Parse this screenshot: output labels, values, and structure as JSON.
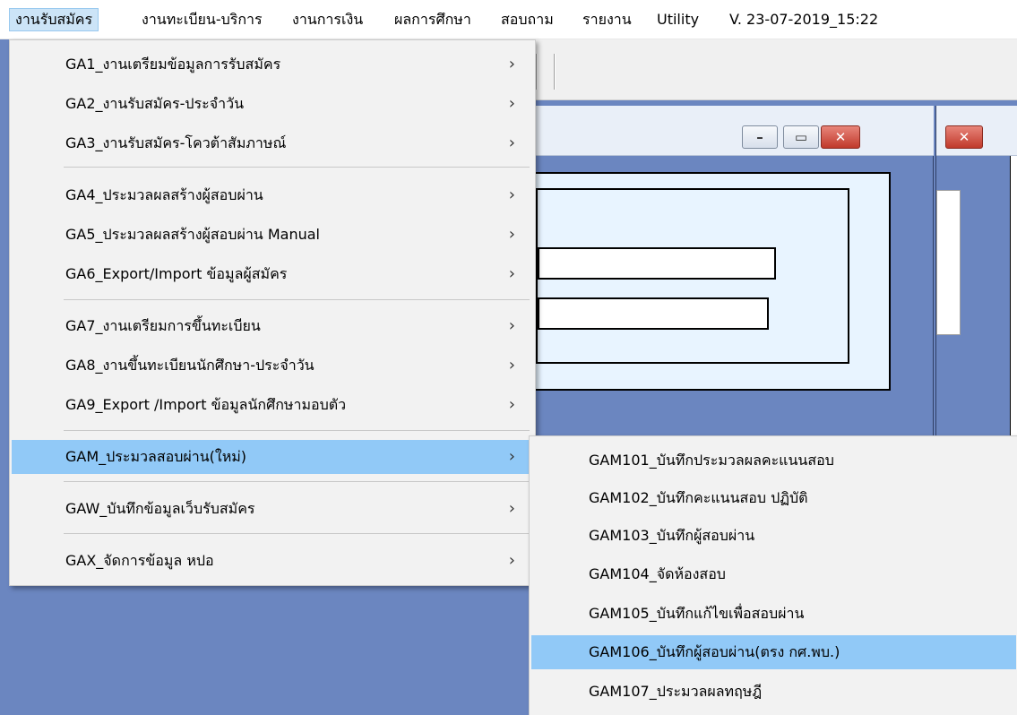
{
  "menubar": {
    "items": [
      "งานรับสมัคร",
      "งานทะเบียน-บริการ",
      "งานการเงิน",
      "ผลการศึกษา",
      "สอบถาม",
      "รายงาน",
      "Utility",
      "V. 23-07-2019_15:22"
    ]
  },
  "main_menu": {
    "items": [
      {
        "label": "GA1_งานเตรียมข้อมูลการรับสมัคร",
        "arrow": "›"
      },
      {
        "label": "GA2_งานรับสมัคร-ประจำวัน",
        "arrow": "›"
      },
      {
        "label": "GA3_งานรับสมัคร-โควต้าสัมภาษณ์",
        "arrow": "›"
      },
      {
        "label": "GA4_ประมวลผลสร้างผู้สอบผ่าน",
        "arrow": "›"
      },
      {
        "label": "GA5_ประมวลผลสร้างผู้สอบผ่าน Manual",
        "arrow": "›"
      },
      {
        "label": "GA6_Export/Import ข้อมูลผู้สมัคร",
        "arrow": "›"
      },
      {
        "label": "GA7_งานเตรียมการขึ้นทะเบียน",
        "arrow": "›"
      },
      {
        "label": "GA8_งานขึ้นทะเบียนนักศึกษา-ประจำวัน",
        "arrow": "›"
      },
      {
        "label": "GA9_Export /Import ข้อมูลนักศึกษามอบตัว",
        "arrow": "›"
      },
      {
        "label": "GAM_ประมวลสอบผ่าน(ใหม่)",
        "arrow": "›"
      },
      {
        "label": "GAW_บันทึกข้อมูลเว็บรับสมัคร",
        "arrow": "›"
      },
      {
        "label": "GAX_จัดการข้อมูล หปอ",
        "arrow": "›"
      }
    ]
  },
  "sub_menu": {
    "items": [
      "GAM101_บันทึกประมวลผลคะแนนสอบ",
      "GAM102_บันทึกคะแนนสอบ ปฏิบัติ",
      "GAM103_บันทึกผู้สอบผ่าน",
      "GAM104_จัดห้องสอบ",
      "GAM105_บันทึกแก้ไขเพื่อสอบผ่าน",
      "GAM106_บันทึกผู้สอบผ่าน(ตรง กศ.พบ.)",
      "GAM107_ประมวลผลทฤษฎี"
    ]
  },
  "window_controls": {
    "minimize": "–",
    "restore": "▭",
    "close": "✕"
  },
  "colors": {
    "menu_highlight": "#91c9f7",
    "menubar_active": "#cce4f7",
    "mdi_background": "#6b86c0"
  }
}
